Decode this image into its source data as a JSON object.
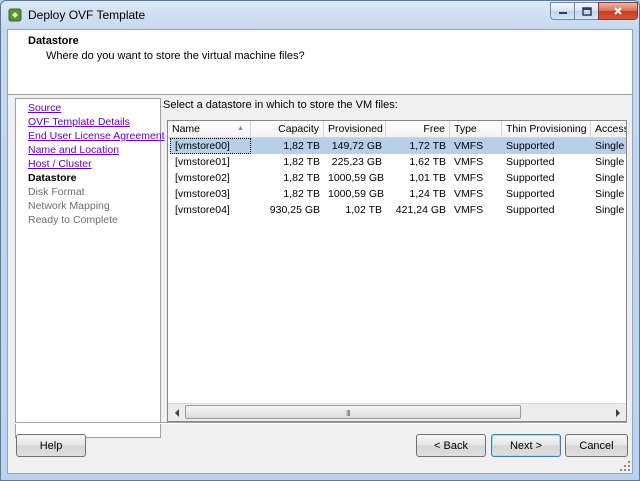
{
  "window": {
    "title": "Deploy OVF Template",
    "min_icon": "minimize-icon",
    "max_icon": "maximize-icon",
    "close_icon": "close-icon"
  },
  "header": {
    "title": "Datastore",
    "subtitle": "Where do you want to store the virtual machine files?"
  },
  "nav": {
    "items": [
      {
        "label": "Source",
        "state": "link"
      },
      {
        "label": "OVF Template Details",
        "state": "link"
      },
      {
        "label": "End User License Agreement",
        "state": "link"
      },
      {
        "label": "Name and Location",
        "state": "link"
      },
      {
        "label": "Host / Cluster",
        "state": "link"
      },
      {
        "label": "Datastore",
        "state": "current"
      },
      {
        "label": "Disk Format",
        "state": "future"
      },
      {
        "label": "Network Mapping",
        "state": "future"
      },
      {
        "label": "Ready to Complete",
        "state": "future"
      }
    ]
  },
  "main": {
    "prompt": "Select a datastore in which to store the VM files:",
    "columns": [
      "Name",
      "Capacity",
      "Provisioned",
      "Free",
      "Type",
      "Thin Provisioning",
      "Access"
    ],
    "rows": [
      [
        "[vmstore00]",
        "1,82 TB",
        "149,72 GB",
        "1,72 TB",
        "VMFS",
        "Supported",
        "Single"
      ],
      [
        "[vmstore01]",
        "1,82 TB",
        "225,23 GB",
        "1,62 TB",
        "VMFS",
        "Supported",
        "Single"
      ],
      [
        "[vmstore02]",
        "1,82 TB",
        "1000,59 GB",
        "1,01 TB",
        "VMFS",
        "Supported",
        "Single"
      ],
      [
        "[vmstore03]",
        "1,82 TB",
        "1000,59 GB",
        "1,24 TB",
        "VMFS",
        "Supported",
        "Single"
      ],
      [
        "[vmstore04]",
        "930,25 GB",
        "1,02 TB",
        "421,24 GB",
        "VMFS",
        "Supported",
        "Single"
      ]
    ],
    "selected_row": 0,
    "scroll_left_icon": "chevron-left-icon",
    "scroll_right_icon": "chevron-right-icon",
    "scroll_grip": "III"
  },
  "buttons": {
    "help": "Help",
    "back": "< Back",
    "next": "Next >",
    "cancel": "Cancel"
  },
  "colors": {
    "selection": "#b7cfe8",
    "link": "#6600cc",
    "close_button": "#c63d20"
  }
}
